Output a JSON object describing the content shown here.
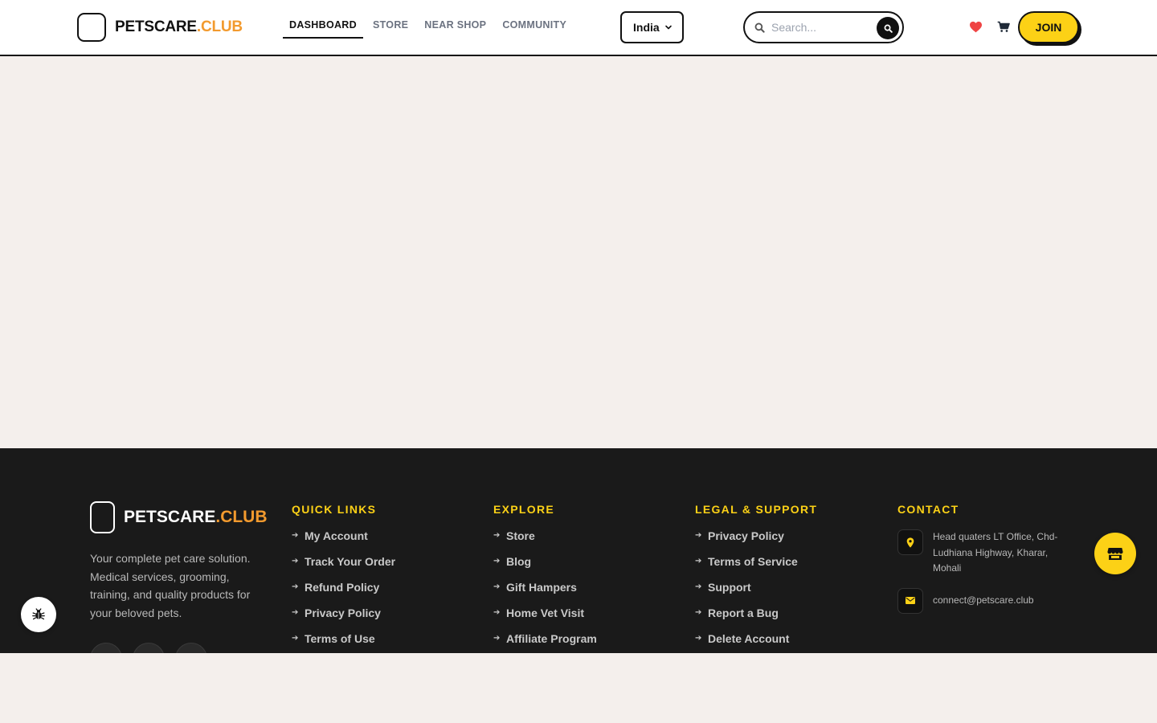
{
  "header": {
    "brand_main": "PETSCARE",
    "brand_accent": ".CLUB",
    "nav": [
      {
        "label": "DASHBOARD",
        "active": true
      },
      {
        "label": "STORE",
        "active": false
      },
      {
        "label": "NEAR SHOP",
        "active": false
      },
      {
        "label": "COMMUNITY",
        "active": false
      }
    ],
    "country": "India",
    "search_placeholder": "Search...",
    "join_label": "JOIN"
  },
  "footer": {
    "brand_main": "PETSCARE",
    "brand_accent": ".CLUB",
    "description": "Your complete pet care solution. Medical services, grooming, training, and quality products for your beloved pets.",
    "columns": [
      {
        "title": "QUICK LINKS",
        "links": [
          "My Account",
          "Track Your Order",
          "Refund Policy",
          "Privacy Policy",
          "Terms of Use"
        ]
      },
      {
        "title": "EXPLORE",
        "links": [
          "Store",
          "Blog",
          "Gift Hampers",
          "Home Vet Visit",
          "Affiliate Program"
        ]
      },
      {
        "title": "LEGAL & SUPPORT",
        "links": [
          "Privacy Policy",
          "Terms of Service",
          "Support",
          "Report a Bug",
          "Delete Account"
        ]
      }
    ],
    "contact": {
      "title": "CONTACT",
      "address": "Head quaters LT Office, Chd-Ludhiana Highway, Kharar, Mohali",
      "email": "connect@petscare.club"
    }
  },
  "colors": {
    "accent_yellow": "#fcd116",
    "brand_orange": "#f29a2e",
    "page_bg": "#f4efec",
    "footer_bg": "#1a1a1a",
    "heart": "#ef4444"
  },
  "icons": [
    "search-icon",
    "chevron-down-icon",
    "heart-icon",
    "cart-icon",
    "map-pin-icon",
    "mail-icon",
    "store-icon",
    "bug-icon",
    "arrow-right-icon"
  ]
}
